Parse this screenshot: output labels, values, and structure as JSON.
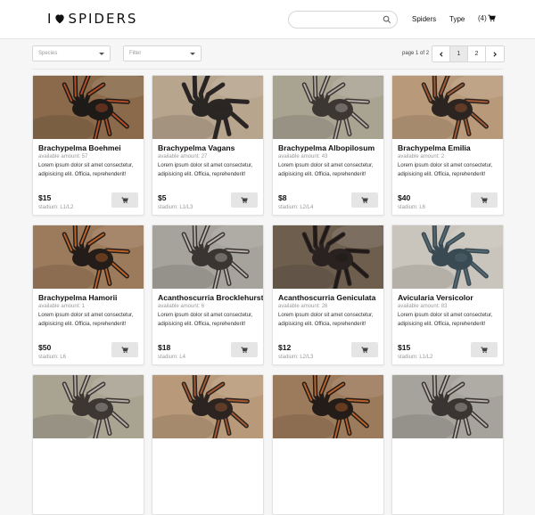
{
  "header": {
    "logo_prefix": "I",
    "logo_word": "SPIDERS",
    "search_placeholder": "",
    "nav_spiders": "Spiders",
    "nav_type": "Type",
    "cart_count": "(4)"
  },
  "toolbar": {
    "species_placeholder": "Species",
    "filter_placeholder": "Filter",
    "page_info": "page 1 of 2",
    "pages": [
      "1",
      "2"
    ],
    "current_page": 1
  },
  "icons": {
    "logo": "heart-icon",
    "search": "search-icon",
    "cart": "cart-icon",
    "prev": "chevron-left-icon",
    "next": "chevron-right-icon"
  },
  "colors": {
    "accent": "#222222",
    "background": "#f6f6f6",
    "button": "#e5e5e5"
  },
  "products": [
    {
      "name": "Brachypelma Boehmei",
      "amount": "available amount: 57",
      "desc": "Lorem ipsum dolor sit amet consectetur, adipisicing elit. Officia, reprehenderit!",
      "price": "$15",
      "stadium": "stadium: L1/L2"
    },
    {
      "name": "Brachypelma Vagans",
      "amount": "available amount: 27",
      "desc": "Lorem ipsum dolor sit amet consectetur, adipisicing elit. Officia, reprehenderit!",
      "price": "$5",
      "stadium": "stadium: L1/L3"
    },
    {
      "name": "Brachypelma Albopilosum",
      "amount": "available amount: 43",
      "desc": "Lorem ipsum dolor sit amet consectetur, adipisicing elit. Officia, reprehenderit!",
      "price": "$8",
      "stadium": "stadium: L2/L4"
    },
    {
      "name": "Brachypelma Emilia",
      "amount": "available amount: 2",
      "desc": "Lorem ipsum dolor sit amet consectetur, adipisicing elit. Officia, reprehenderit!",
      "price": "$40",
      "stadium": "stadium: L6"
    },
    {
      "name": "Brachypelma Hamorii",
      "amount": "available amount: 1",
      "desc": "Lorem ipsum dolor sit amet consectetur, adipisicing elit. Officia, reprehenderit!",
      "price": "$50",
      "stadium": "stadium: L6"
    },
    {
      "name": "Acanthoscurria Brocklehursti",
      "amount": "available amount: 6",
      "desc": "Lorem ipsum dolor sit amet consectetur, adipisicing elit. Officia, reprehenderit!",
      "price": "$18",
      "stadium": "stadium: L4"
    },
    {
      "name": "Acanthoscurria Geniculata",
      "amount": "available amount: 26",
      "desc": "Lorem ipsum dolor sit amet consectetur, adipisicing elit. Officia, reprehenderit!",
      "price": "$12",
      "stadium": "stadium: L2/L3"
    },
    {
      "name": "Avicularia Versicolor",
      "amount": "available amount: 83",
      "desc": "Lorem ipsum dolor sit amet consectetur, adipisicing elit. Officia, reprehenderit!",
      "price": "$15",
      "stadium": "stadium: L1/L2"
    }
  ]
}
